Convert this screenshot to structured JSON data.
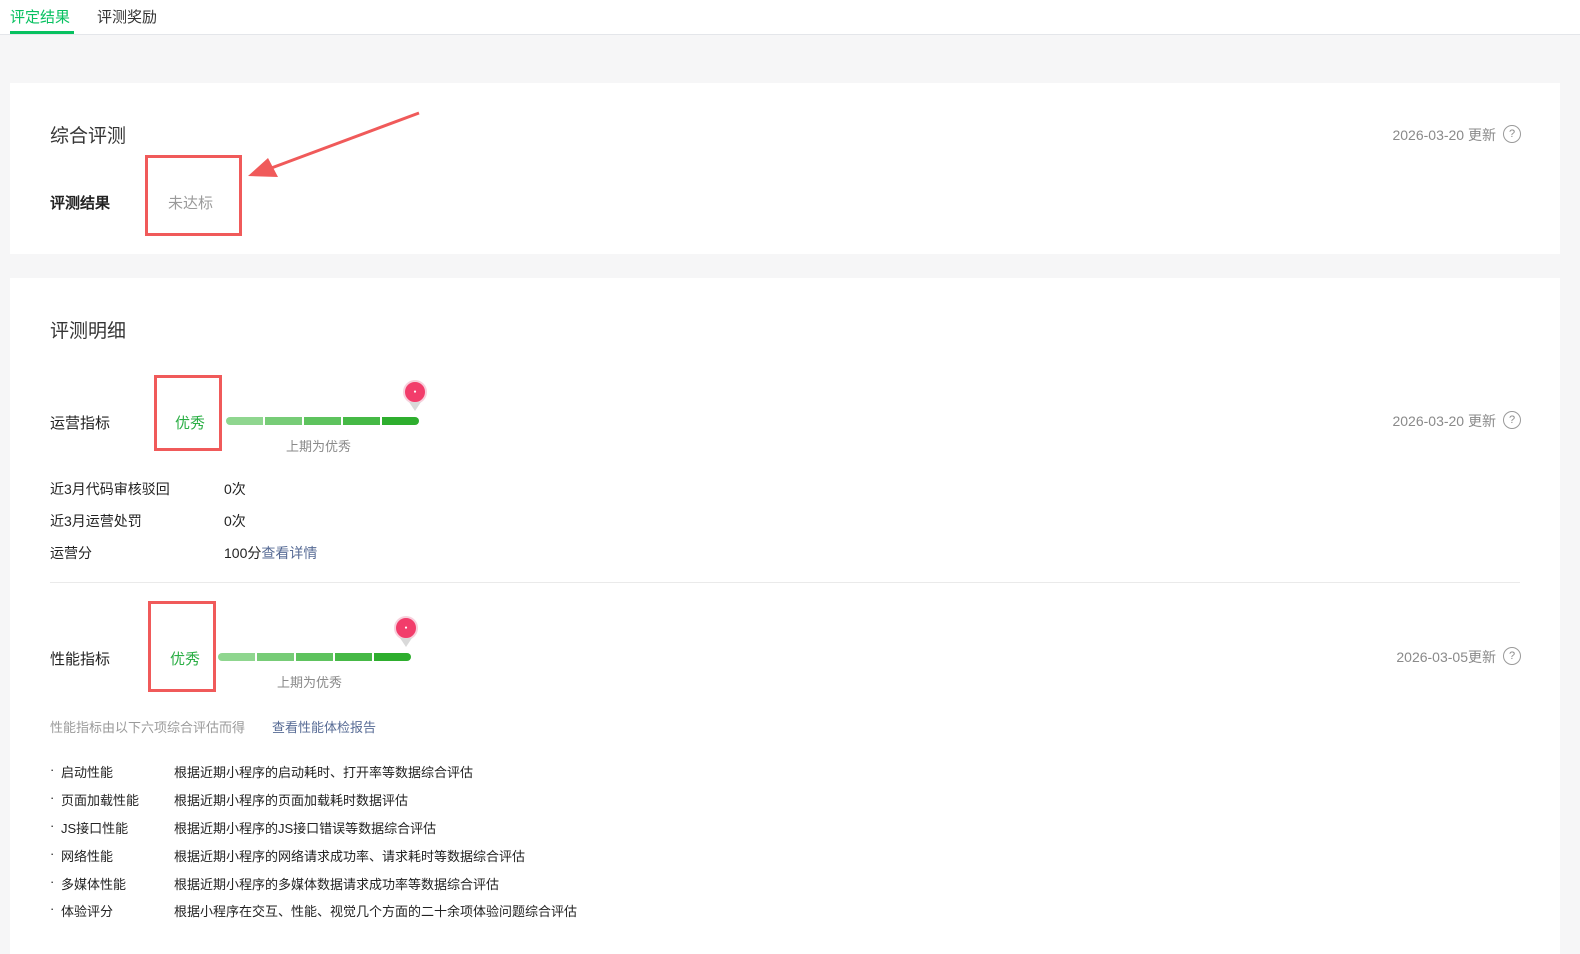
{
  "tabs": [
    {
      "label": "评定结果",
      "active": true
    },
    {
      "label": "评测奖励",
      "active": false
    }
  ],
  "overall": {
    "title": "综合评测",
    "updated": "2026-03-20 更新",
    "result_label": "评测结果",
    "result_value": "未达标"
  },
  "detail": {
    "title": "评测明细",
    "operation": {
      "label": "运营指标",
      "grade": "优秀",
      "previous": "上期为优秀",
      "updated": "2026-03-20 更新",
      "level_filled": 5,
      "level_total": 5,
      "stats": [
        {
          "key": "近3月代码审核驳回",
          "value": "0次"
        },
        {
          "key": "近3月运营处罚",
          "value": "0次"
        },
        {
          "key": "运营分",
          "value": "100分",
          "link": "查看详情"
        }
      ]
    },
    "performance": {
      "label": "性能指标",
      "grade": "优秀",
      "previous": "上期为优秀",
      "updated": "2026-03-05更新",
      "level_filled": 5,
      "level_total": 5,
      "note": "性能指标由以下六项综合评估而得",
      "report_link": "查看性能体检报告",
      "items": [
        {
          "name": "启动性能",
          "desc": "根据近期小程序的启动耗时、打开率等数据综合评估"
        },
        {
          "name": "页面加载性能",
          "desc": "根据近期小程序的页面加载耗时数据评估"
        },
        {
          "name": "JS接口性能",
          "desc": "根据近期小程序的JS接口错误等数据综合评估"
        },
        {
          "name": "网络性能",
          "desc": "根据近期小程序的网络请求成功率、请求耗时等数据综合评估"
        },
        {
          "name": "多媒体性能",
          "desc": "根据近期小程序的多媒体数据请求成功率等数据综合评估"
        },
        {
          "name": "体验评分",
          "desc": "根据小程序在交互、性能、视觉几个方面的二十余项体验问题综合评估"
        }
      ]
    }
  },
  "colors": {
    "accent_green": "#07c160",
    "grade_green": "#2aae44",
    "fail_gray": "#9a9a9a",
    "link_blue": "#576b95",
    "annotation_red": "#f05a5a"
  },
  "icons": {
    "help": "question-circle-icon",
    "level_marker": "map-pin-icon",
    "annotation": "arrow-icon"
  },
  "help_glyph": "?",
  "bullet_glyph": "·"
}
